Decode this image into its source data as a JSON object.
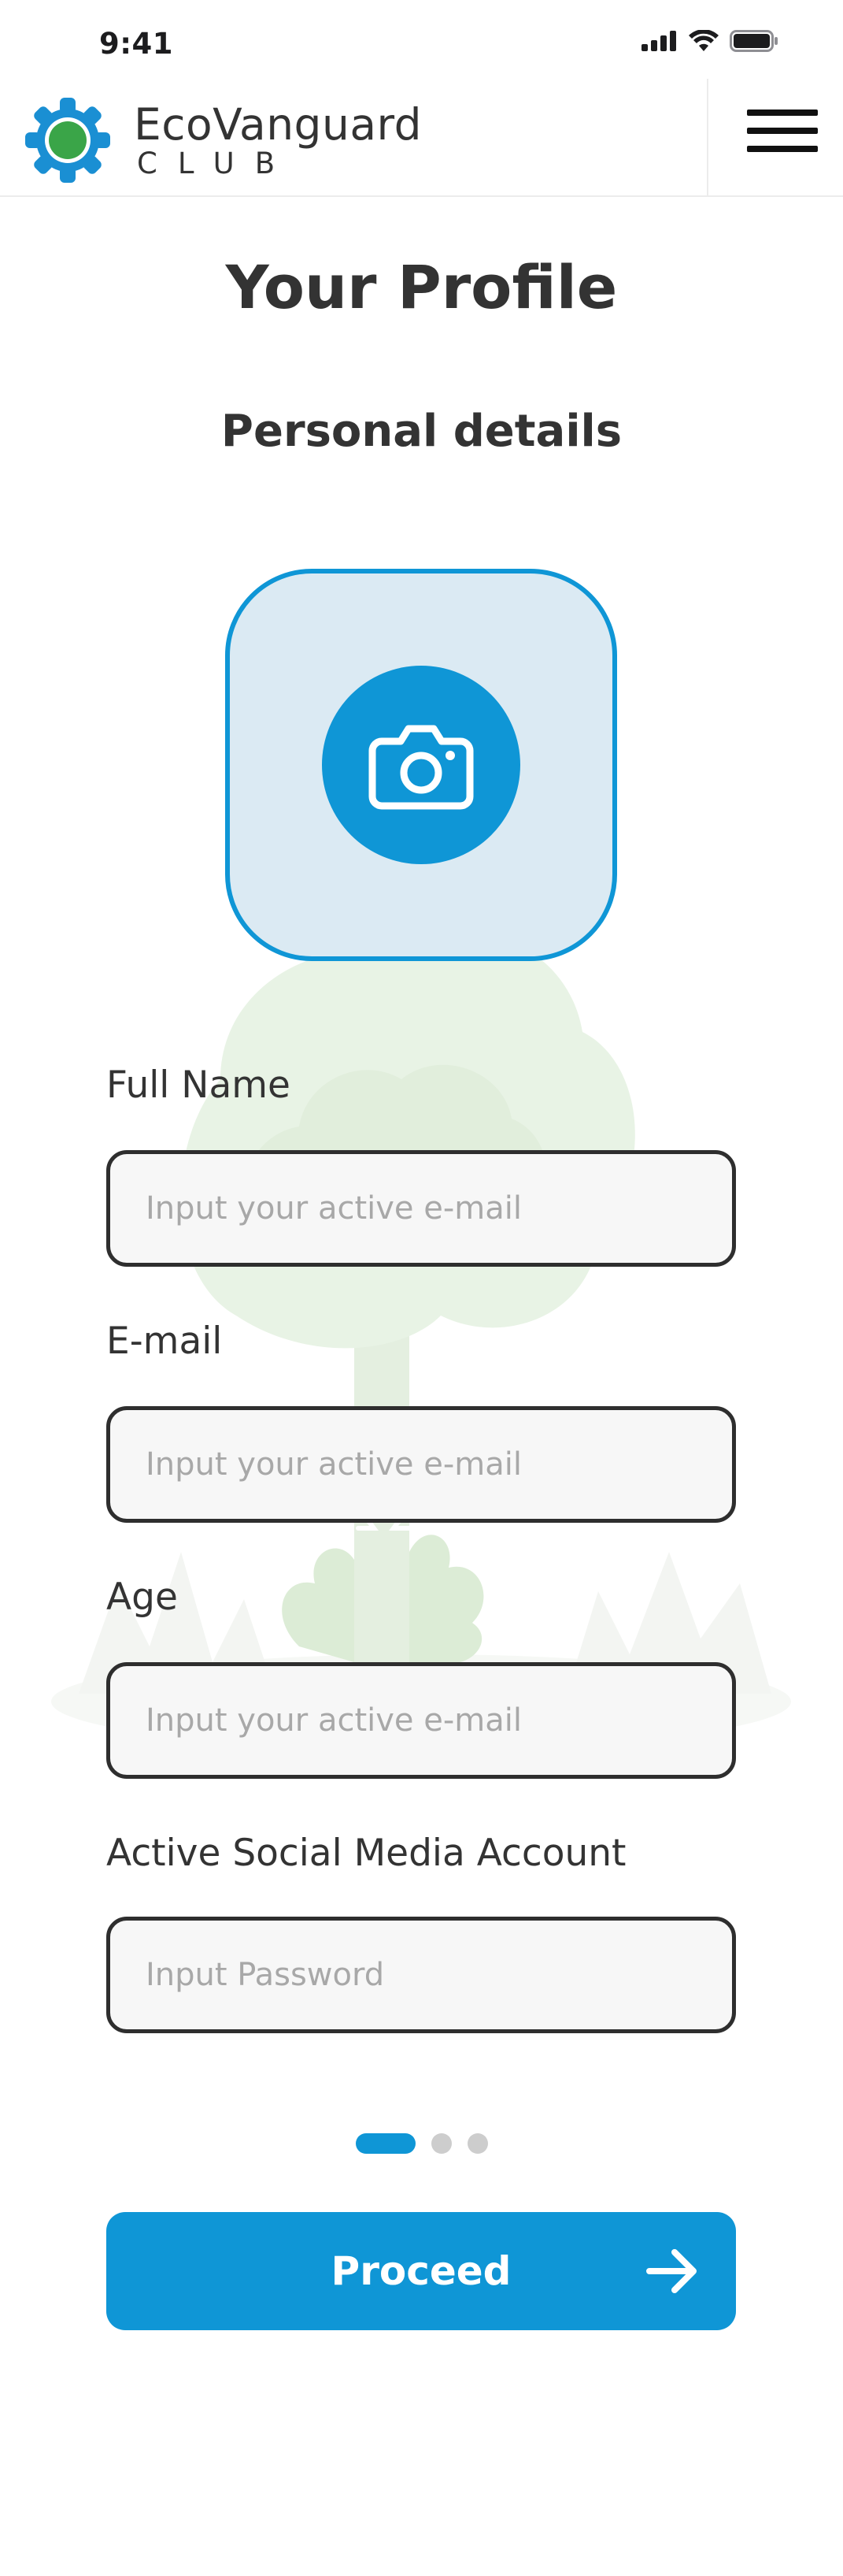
{
  "status_bar": {
    "time": "9:41",
    "icons": [
      "signal-icon",
      "wifi-icon",
      "battery-icon"
    ]
  },
  "header": {
    "brand_name": "EcoVanguard",
    "brand_sub": "CLUB",
    "logo_icon": "gear-logo-icon",
    "menu_icon": "hamburger-menu-icon"
  },
  "page": {
    "title": "Your Profile",
    "section_title": "Personal details"
  },
  "photo_upload": {
    "icon": "camera-icon"
  },
  "form": {
    "fields": [
      {
        "label": "Full Name",
        "placeholder": "Input your active e-mail",
        "value": ""
      },
      {
        "label": "E-mail",
        "placeholder": "Input your active e-mail",
        "value": ""
      },
      {
        "label": "Age",
        "placeholder": "Input your active e-mail",
        "value": ""
      },
      {
        "label": "Active Social Media Account",
        "placeholder": "Input Password",
        "value": ""
      }
    ]
  },
  "pager": {
    "total": 3,
    "current": 1
  },
  "proceed": {
    "label": "Proceed",
    "icon": "arrow-right-icon"
  },
  "colors": {
    "accent": "#0f96d6",
    "upload_bg": "#dbeaf3",
    "text": "#333333",
    "illustration": "#e8f3e5"
  }
}
